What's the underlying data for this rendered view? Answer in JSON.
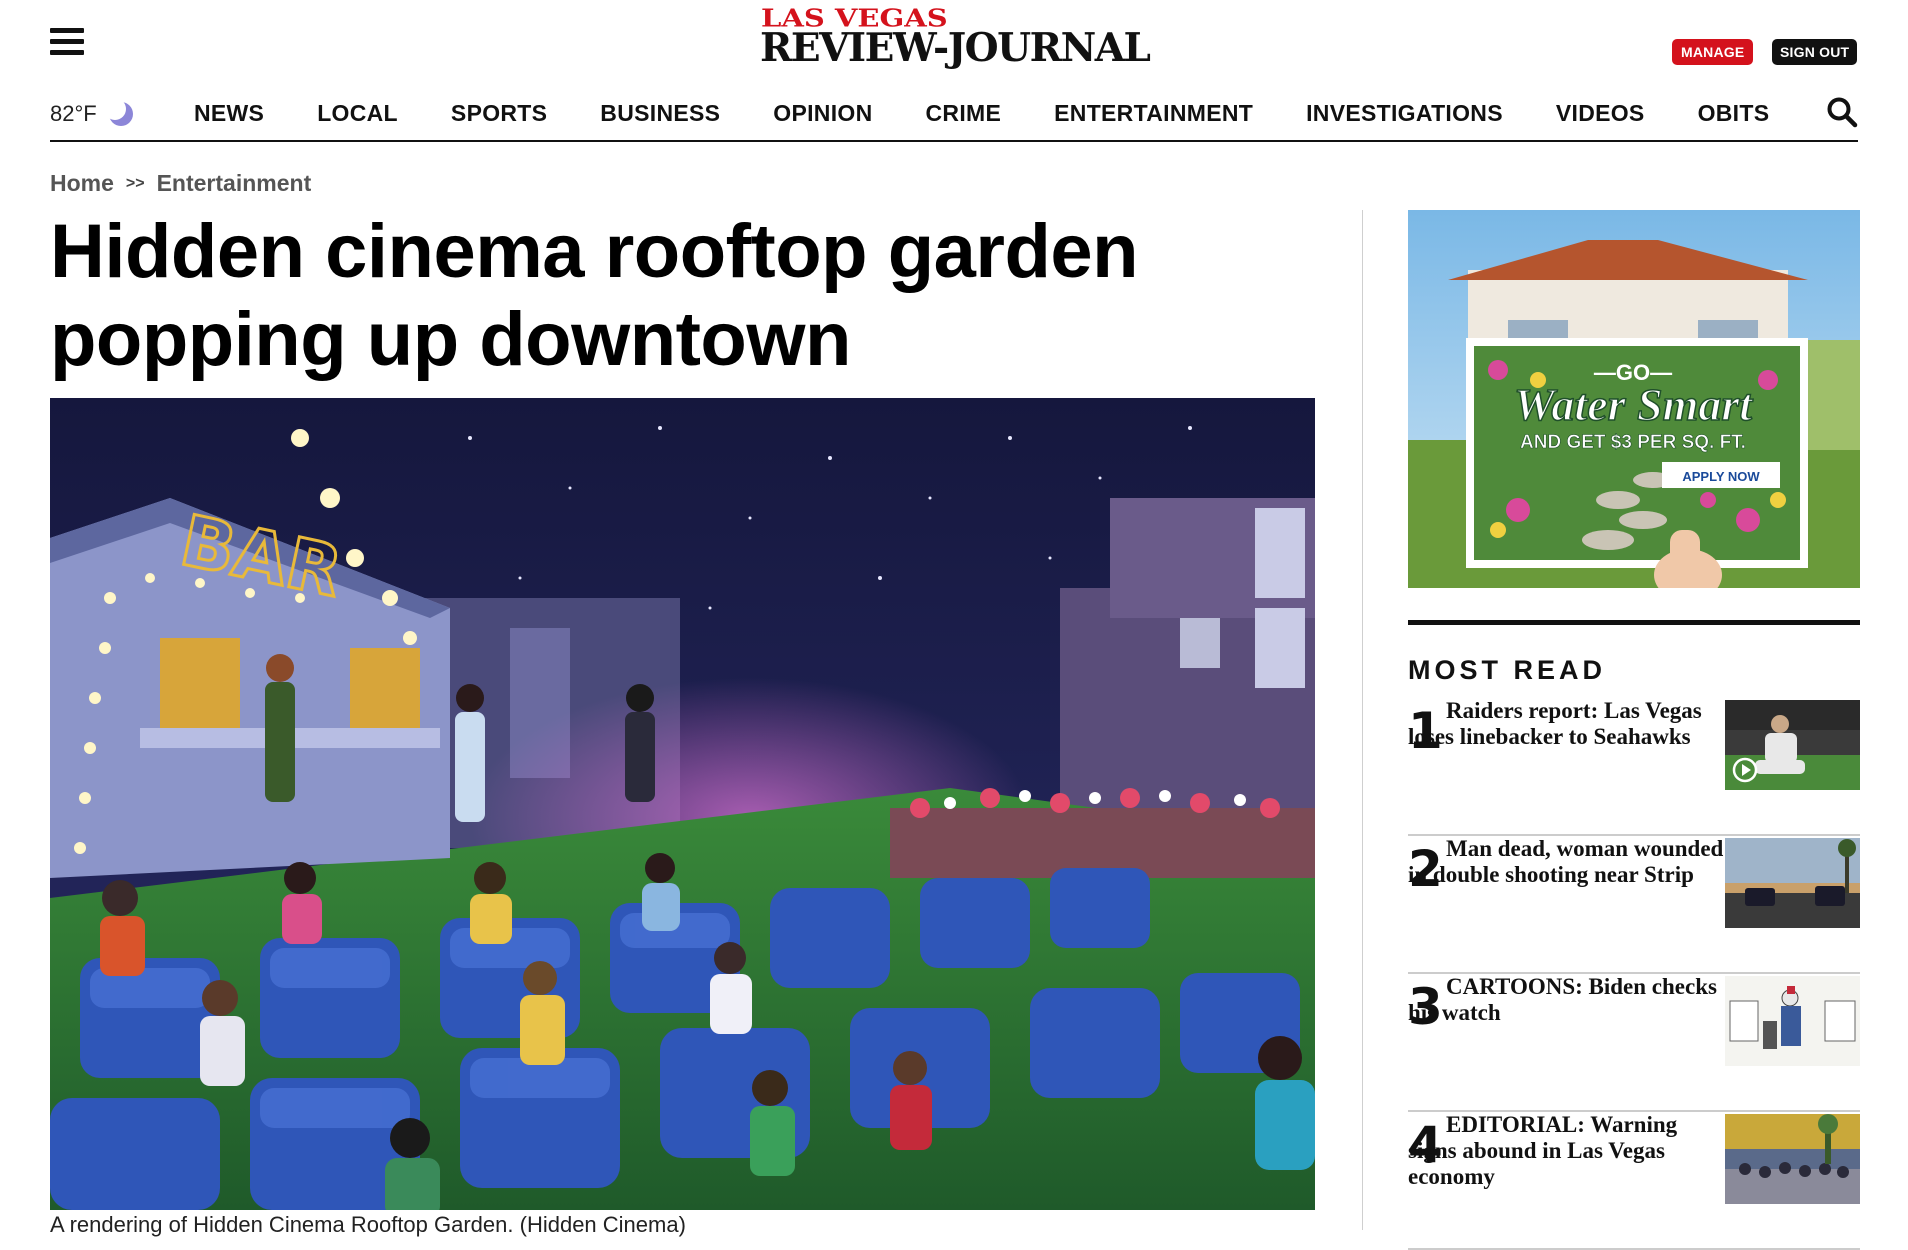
{
  "header": {
    "menu_icon": "hamburger-menu-icon",
    "logo_line1": "LAS VEGAS",
    "logo_line2": "REVIEW-JOURNAL",
    "manage_label": "MANAGE",
    "signout_label": "SIGN OUT",
    "brand_red": "#d4121c"
  },
  "nav": {
    "temperature": "82°F",
    "weather_icon": "moon-icon",
    "items": [
      "NEWS",
      "LOCAL",
      "SPORTS",
      "BUSINESS",
      "OPINION",
      "CRIME",
      "ENTERTAINMENT",
      "INVESTIGATIONS",
      "VIDEOS",
      "OBITS"
    ],
    "search_icon": "search-icon"
  },
  "breadcrumb": {
    "home": "Home",
    "separator": ">>",
    "section": "Entertainment"
  },
  "article": {
    "headline": "Hidden cinema rooftop garden popping up downtown",
    "caption": "A rendering of Hidden Cinema Rooftop Garden. (Hidden Cinema)",
    "image_sign": "BAR"
  },
  "ad": {
    "go": "—GO—",
    "brand": "Water Smart",
    "offer": "AND GET $3 PER SQ. FT.",
    "cta": "APPLY NOW"
  },
  "most_read": {
    "title": "MOST READ",
    "items": [
      {
        "rank": "1",
        "headline": "Raiders report: Las Vegas loses linebacker to Seahawks",
        "has_video": true
      },
      {
        "rank": "2",
        "headline": "Man dead, woman wounded in double shooting near Strip",
        "has_video": false
      },
      {
        "rank": "3",
        "headline": "CARTOONS: Biden checks his watch",
        "has_video": false
      },
      {
        "rank": "4",
        "headline": "EDITORIAL: Warning signs abound in Las Vegas economy",
        "has_video": false
      }
    ]
  }
}
